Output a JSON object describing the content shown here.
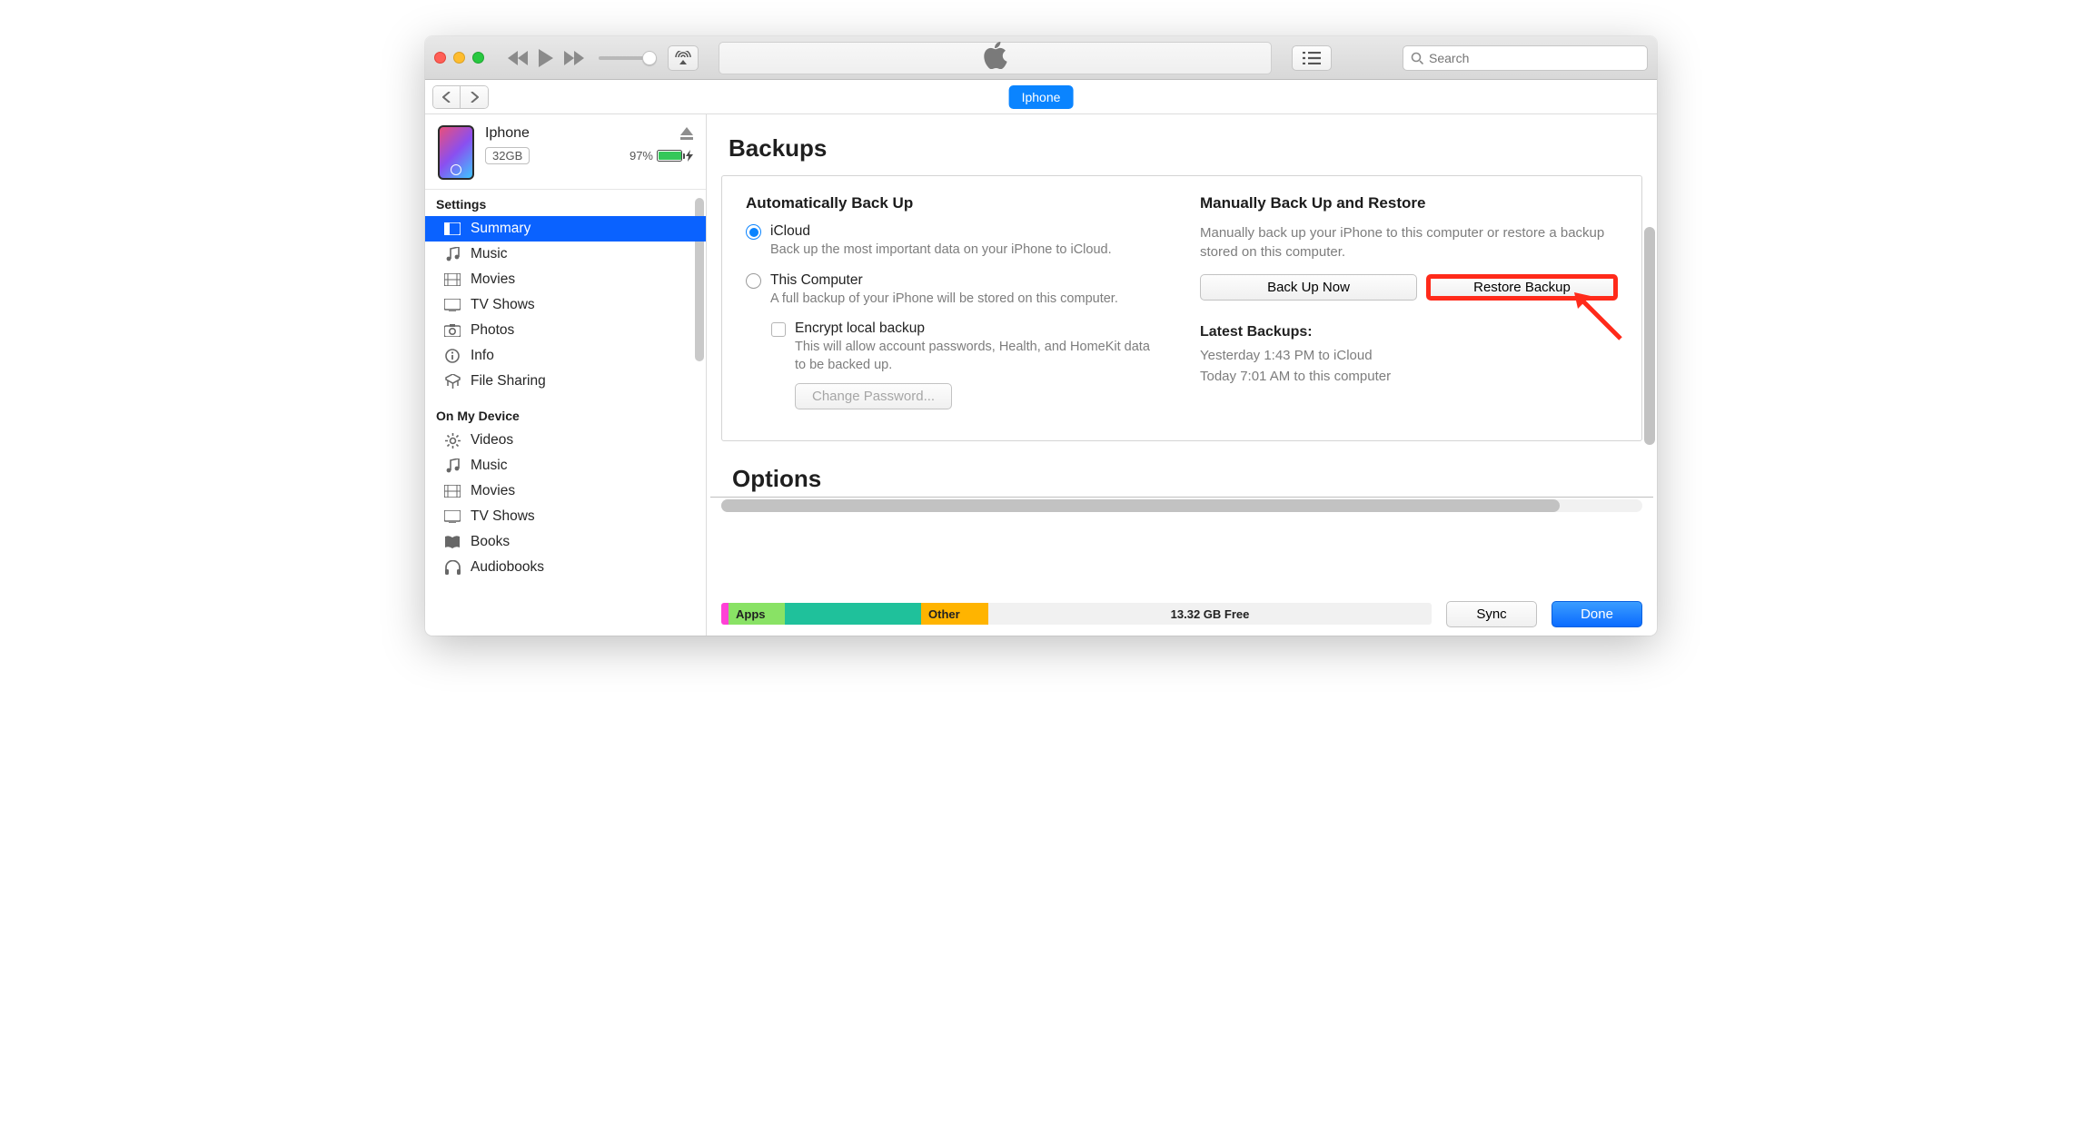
{
  "tabrow": {
    "device_tab": "Iphone"
  },
  "search": {
    "placeholder": "Search"
  },
  "device": {
    "name": "Iphone",
    "capacity": "32GB",
    "battery_pct": "97%"
  },
  "sidebar": {
    "section_settings": "Settings",
    "section_device": "On My Device",
    "settings": [
      {
        "label": "Summary"
      },
      {
        "label": "Music"
      },
      {
        "label": "Movies"
      },
      {
        "label": "TV Shows"
      },
      {
        "label": "Photos"
      },
      {
        "label": "Info"
      },
      {
        "label": "File Sharing"
      }
    ],
    "ondevice": [
      {
        "label": "Videos"
      },
      {
        "label": "Music"
      },
      {
        "label": "Movies"
      },
      {
        "label": "TV Shows"
      },
      {
        "label": "Books"
      },
      {
        "label": "Audiobooks"
      }
    ]
  },
  "backups": {
    "heading": "Backups",
    "auto_head": "Automatically Back Up",
    "icloud_label": "iCloud",
    "icloud_desc": "Back up the most important data on your iPhone to iCloud.",
    "thiscomp_label": "This Computer",
    "thiscomp_desc": "A full backup of your iPhone will be stored on this computer.",
    "encrypt_label": "Encrypt local backup",
    "encrypt_desc": "This will allow account passwords, Health, and HomeKit data to be backed up.",
    "change_pw": "Change Password...",
    "manual_head": "Manually Back Up and Restore",
    "manual_desc": "Manually back up your iPhone to this computer or restore a backup stored on this computer.",
    "backup_now": "Back Up Now",
    "restore": "Restore Backup",
    "latest_head": "Latest Backups:",
    "latest_1": "Yesterday 1:43 PM to iCloud",
    "latest_2": "Today 7:01 AM to this computer"
  },
  "options": {
    "heading": "Options"
  },
  "storage": {
    "apps_label": "Apps",
    "other_label": "Other",
    "free_label": "13.32 GB Free"
  },
  "footer": {
    "sync": "Sync",
    "done": "Done"
  }
}
